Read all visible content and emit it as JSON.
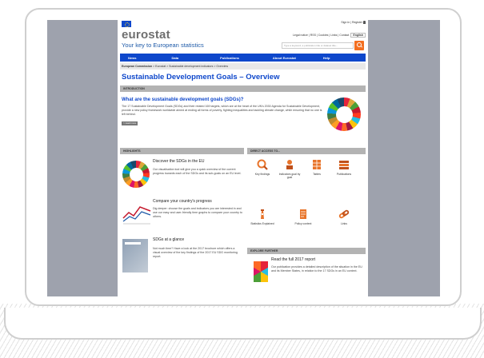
{
  "header": {
    "sign_in": "Sign in | Register",
    "logo": "eurostat",
    "tagline": "Your key to European statistics",
    "util_links": "Legal notice | RSS | Cookies | Links | Contact",
    "language": "English",
    "search_placeholder": "Type a keyword, a publication title or dataset title..."
  },
  "nav": [
    "News",
    "Data",
    "Publications",
    "About Eurostat",
    "Help"
  ],
  "breadcrumb": {
    "root": "European Commission",
    "path": " > Eurostat > Sustainable development indicators > Overview"
  },
  "page_title": "Sustainable Development Goals – Overview",
  "intro": {
    "bar": "INTRODUCTION",
    "question": "What are the sustainable development goals (SDGs)?",
    "text": "The 17 Sustainable Development Goals (SDGs) and their related 169 targets, which are at the heart of the UN's 2030 Agenda for Sustainable Development, provide a new policy framework worldwide aimed at ending all forms of poverty, fighting inequalities and tackling climate change, while ensuring that no one is left behind.",
    "read_more": "> read more"
  },
  "highlights": {
    "bar": "HIGHLIGHTS",
    "items": [
      {
        "title": "Discover the SDGs in the EU",
        "text": "Our visualisation tool will give you a quick overview of the current progress towards each of the SDGs and its sub-goals on an EU level."
      },
      {
        "title": "Compare your country's progress",
        "text": "Dig deeper: choose the goals and indicators you are interested in and use our easy and user-friendly time graphs to compare your country to others."
      },
      {
        "title": "SDGs at a glance",
        "text": "Not much time? Have a look at the 2017 brochure which offers a visual overview of the key findings of the 2017 EU SDG monitoring report."
      }
    ]
  },
  "direct_access": {
    "bar": "DIRECT ACCESS TO...",
    "tiles": [
      "Key findings",
      "Indicators goal by goal",
      "Tables",
      "Publications",
      "Statistics Explained",
      "Policy context",
      "Links"
    ]
  },
  "explore": {
    "bar": "EXPLORE FURTHER",
    "title": "Read the full 2017 report",
    "text": "Our publication provides a detailed description of the situation in the EU and its Member States, in relation to the 17 SDGs in an EU context."
  },
  "colors": {
    "nav_blue": "#0e47cb",
    "orange": "#f36f21",
    "gray_bar": "#b3b3b3",
    "frame_bg": "#9ea2ad"
  }
}
